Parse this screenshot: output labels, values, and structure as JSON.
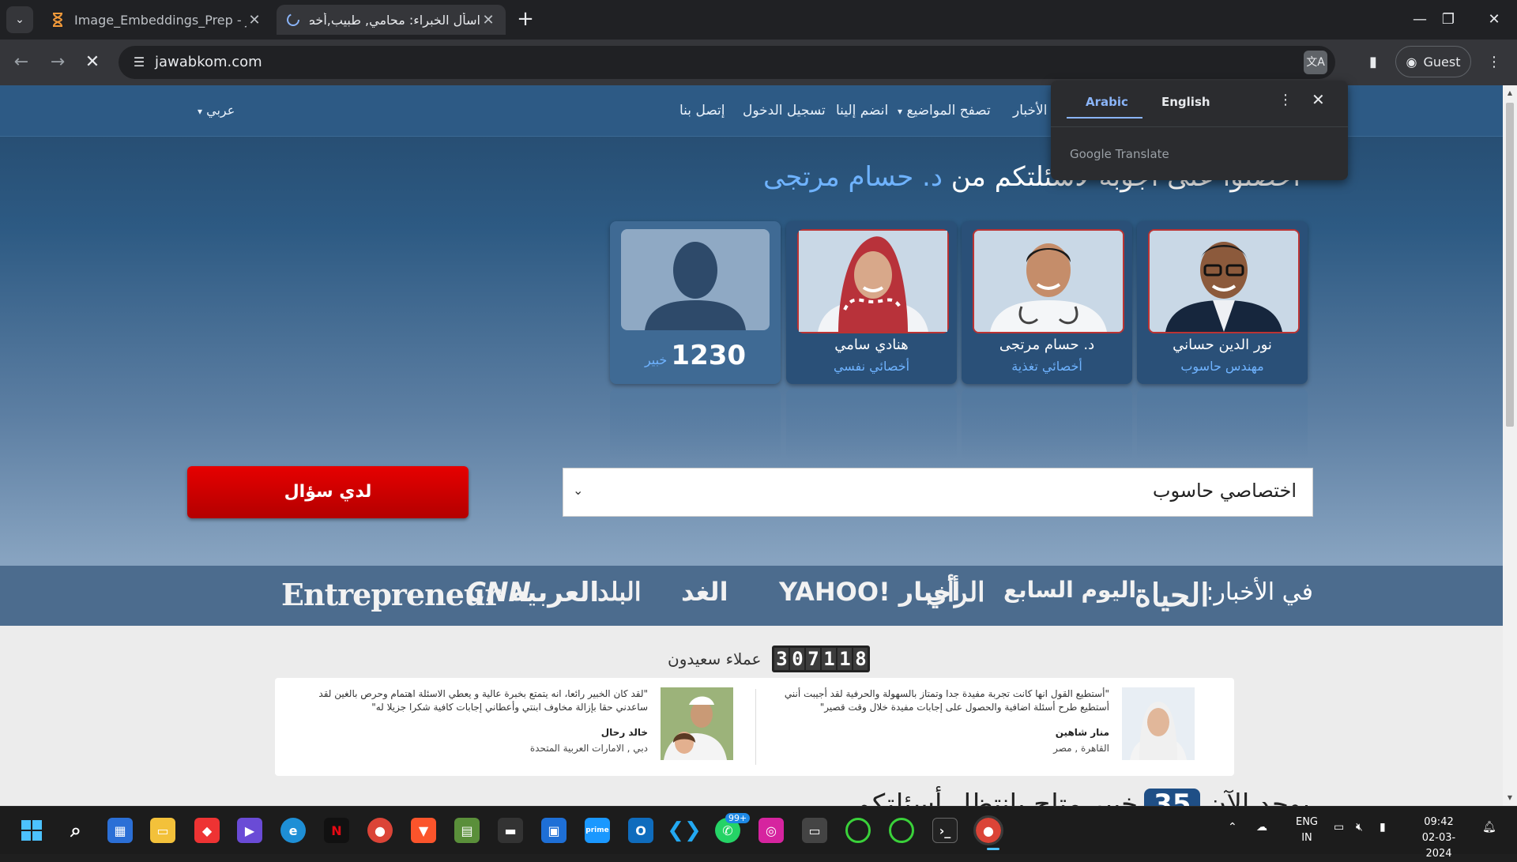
{
  "browser": {
    "tabs": [
      {
        "title": "Image_Embeddings_Prep - Jupy",
        "icon": "hourglass-icon"
      },
      {
        "title": "اسأل الخبراء: محامي, طبيب,أخصائ",
        "icon": "loading-icon"
      }
    ],
    "url": "jawabkom.com",
    "guest_label": "Guest"
  },
  "translate_popup": {
    "source_lang": "Arabic",
    "target_lang": "English",
    "brand": "Google Translate"
  },
  "site": {
    "nav": {
      "news": "الأخبار",
      "browse_topics": "تصفح المواضيع",
      "join_us": "انضم إلينا",
      "login": "تسجيل الدخول",
      "contact": "إتصل بنا",
      "language": "عربي"
    },
    "headline_prefix": "احصلوا على أجوبة لأسئلتكم من",
    "headline_name": "د. حسام مرتجى",
    "experts": [
      {
        "name": "نور الدين حساني",
        "role": "مهندس حاسوب"
      },
      {
        "name": "د. حسام مرتجى",
        "role": "أخصائي تغذية"
      },
      {
        "name": "هنادي سامي",
        "role": "أخصائي نفسي"
      }
    ],
    "expert_count": {
      "number": "1230",
      "label": "خبير"
    },
    "ask_button": "لدي سؤال",
    "topic_select": {
      "value": "اختصاصي حاسوب"
    },
    "news_label": "في الأخبار:",
    "news_logos": [
      "الحياة",
      "اليوم السابع",
      "الرأي",
      "YAHOO! أخبار",
      "الغد",
      "البلد",
      "العربية",
      "CNN",
      "Entrepreneur"
    ],
    "counter": {
      "digits": [
        "3",
        "0",
        "7",
        "1",
        "1",
        "8"
      ],
      "label": "عملاء سعيدون"
    },
    "testimonials": [
      {
        "quote": "\"أستطيع القول انها كانت تجربة مفيدة جدا وتمتاز بالسهولة والحرفية لقد أجيبت أنني أستطيع طرح أسئلة اضافية والحصول على إجابات مفيدة خلال وقت قصير\"",
        "name": "منار شاهين",
        "location": "القاهرة , مصر"
      },
      {
        "quote": "\"لقد كان الخبير رائعا، انه يتمتع بخبرة عالية و يعطي الاسئلة اهتمام وحرص بالغين لقد ساعدني حقا بإزالة مخاوف ابنتي وأعطاني إجابات كافية شكرا جزيلا له\"",
        "name": "خالد رحال",
        "location": "دبي , الامارات العربية المتحدة"
      }
    ],
    "experts_now": {
      "prefix": "يوجد الآن",
      "number": "35",
      "suffix": "خبير متاح بانتظار أسئلتكم"
    }
  },
  "taskbar": {
    "whatsapp_badge": "99+",
    "lang_line1": "ENG",
    "lang_line2": "IN",
    "time": "09:42",
    "date": "02-03-2024"
  },
  "colors": {
    "accent_blue": "#6fb3ff",
    "ask_red": "#e60000",
    "nav_bg": "#2d5a85"
  }
}
